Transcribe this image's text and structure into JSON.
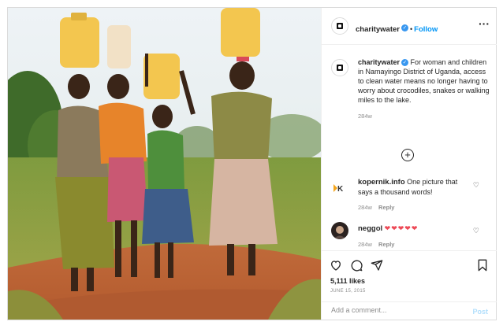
{
  "post": {
    "author": {
      "username": "charitywater",
      "verified": true,
      "follow_label": "Follow",
      "separator": "•",
      "more_icon": "ellipsis-icon"
    },
    "caption": {
      "username": "charitywater",
      "text": "For woman and children in Namayingo District of Uganda, access to clean water means no longer having to worry about crocodiles, snakes or walking miles to the lake.",
      "age": "284w"
    },
    "load_more_icon": "plus-circle-icon",
    "comments": [
      {
        "username": "kopernik.info",
        "text": "One picture that says a thousand words!",
        "age": "284w",
        "reply_label": "Reply"
      },
      {
        "username": "neggol",
        "text": "❤❤❤❤❤",
        "age": "284w",
        "reply_label": "Reply"
      }
    ],
    "likes": "5,111 likes",
    "date": "JUNE 15, 2015",
    "add_comment": {
      "placeholder": "Add a comment...",
      "post_label": "Post"
    },
    "colors": {
      "follow": "#0095f6",
      "heart": "#ed4956",
      "post_disabled": "#b2dffc"
    }
  }
}
